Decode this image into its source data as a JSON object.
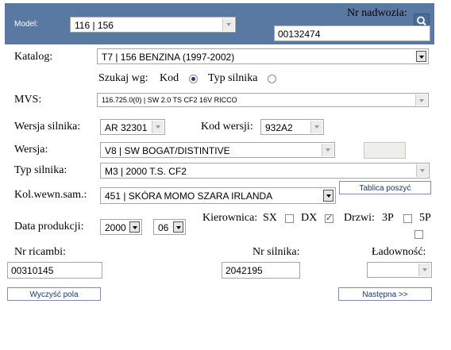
{
  "header": {
    "model_label": "Model:",
    "model_value": "116 | 156",
    "chassis_label": "Nr nadwozia:",
    "chassis_value": "00132474"
  },
  "catalog": {
    "label": "Katalog:",
    "value": "T7  |  156  BENZINA  (1997-2002)"
  },
  "search_by": {
    "label": "Szukaj wg:",
    "option_code": "Kod",
    "option_engine": "Typ silnika",
    "selected": "Kod"
  },
  "mvs": {
    "label": "MVS:",
    "value": "116.725.0(0) | SW 2.0 TS CF2 16V RICCO"
  },
  "engine_version": {
    "label": "Wersja silnika:",
    "value": "AR 32301"
  },
  "version_code": {
    "label": "Kod wersji:",
    "value": "932A2"
  },
  "version": {
    "label": "Wersja:",
    "value": "V8 | SW BOGAT/DISTINTIVE"
  },
  "engine_type": {
    "label": "Typ silnika:",
    "value": "M3 | 2000 T.S. CF2"
  },
  "interior_color": {
    "label": "Kol.wewn.sam.:",
    "value": "451 | SKÓRA MOMO SZARA IRLANDA"
  },
  "upholstery_button": "Tablica poszyć",
  "production_date": {
    "label": "Data produkcji:",
    "year": "2000",
    "month": "06"
  },
  "steering": {
    "label": "Kierownica:",
    "sx": "SX",
    "dx": "DX",
    "sx_checked": false,
    "dx_checked": true
  },
  "doors": {
    "label": "Drzwi:",
    "p3": "3P",
    "p5": "5P",
    "p3_checked": false,
    "p5_checked": false
  },
  "spare_number": {
    "label": "Nr ricambi:",
    "value": "00310145"
  },
  "engine_number": {
    "label": "Nr silnika:",
    "value": "2042195"
  },
  "load_capacity": {
    "label": "Ładowność:",
    "value": ""
  },
  "buttons": {
    "clear": "Wyczyść pola",
    "next": "Następna >>"
  }
}
